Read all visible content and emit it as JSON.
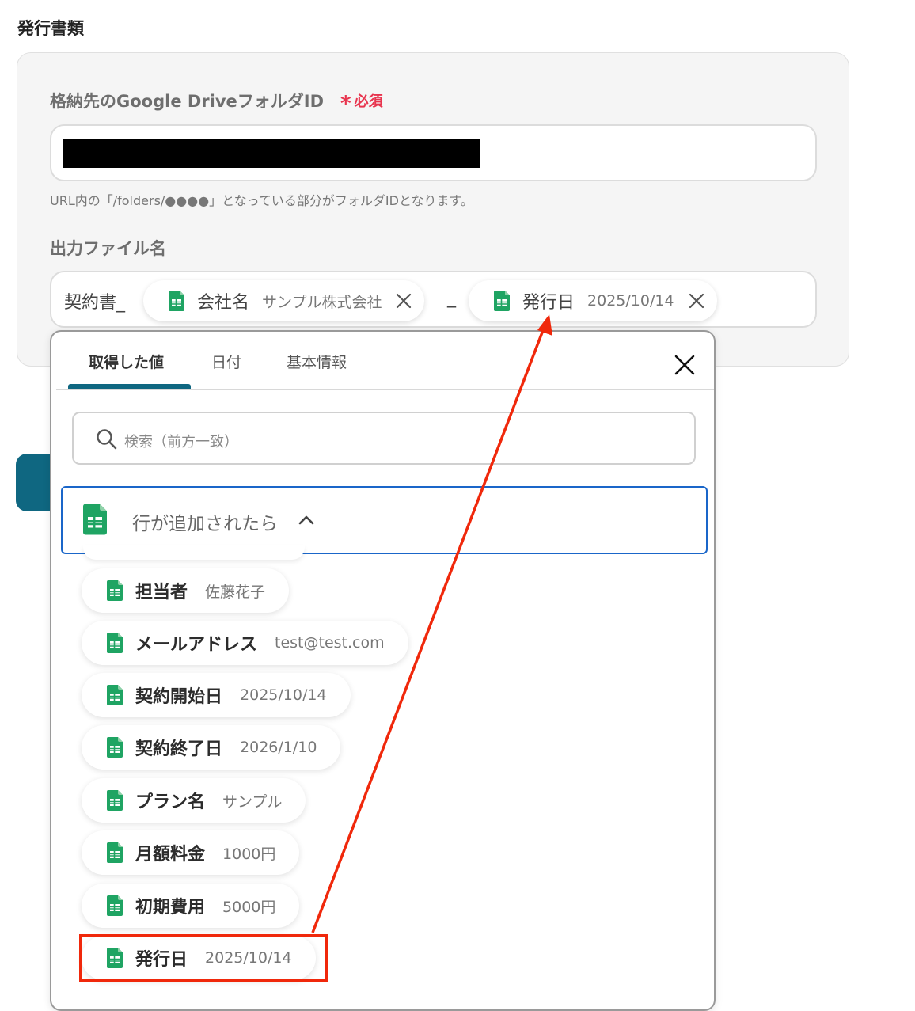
{
  "section": {
    "title": "発行書類"
  },
  "folder_field": {
    "label": "格納先のGoogle DriveフォルダID",
    "required_mark": "*",
    "required_label": "必須",
    "hint": "URL内の「/folders/●●●●」となっている部分がフォルダIDとなります。"
  },
  "filename_field": {
    "label": "出力ファイル名",
    "prefix_text": "契約書_",
    "separator_text": "_",
    "chips": [
      {
        "name": "会社名",
        "value": "サンプル株式会社"
      },
      {
        "name": "発行日",
        "value": "2025/10/14"
      }
    ]
  },
  "popup": {
    "tabs": [
      {
        "label": "取得した値",
        "active": true
      },
      {
        "label": "日付",
        "active": false
      },
      {
        "label": "基本情報",
        "active": false
      }
    ],
    "search_placeholder": "検索（前方一致）",
    "group": {
      "title": "行が追加されたら",
      "expanded": true
    },
    "items": [
      {
        "name": "担当者",
        "value": "佐藤花子"
      },
      {
        "name": "メールアドレス",
        "value": "test@test.com"
      },
      {
        "name": "契約開始日",
        "value": "2025/10/14"
      },
      {
        "name": "契約終了日",
        "value": "2026/1/10"
      },
      {
        "name": "プラン名",
        "value": "サンプル"
      },
      {
        "name": "月額料金",
        "value": "1000円"
      },
      {
        "name": "初期費用",
        "value": "5000円"
      },
      {
        "name": "発行日",
        "value": "2025/10/14",
        "highlighted": true
      }
    ]
  },
  "colors": {
    "accent": "#0f6781",
    "required": "#e8344e",
    "group_border": "#1a66c9",
    "annotation": "#f0280b",
    "sheets_green": "#1fa463"
  },
  "icons": {
    "sheet": "google-sheets-icon",
    "close": "close-icon",
    "remove": "remove-chip-icon",
    "search": "search-icon",
    "collapse": "chevron-up-icon"
  }
}
